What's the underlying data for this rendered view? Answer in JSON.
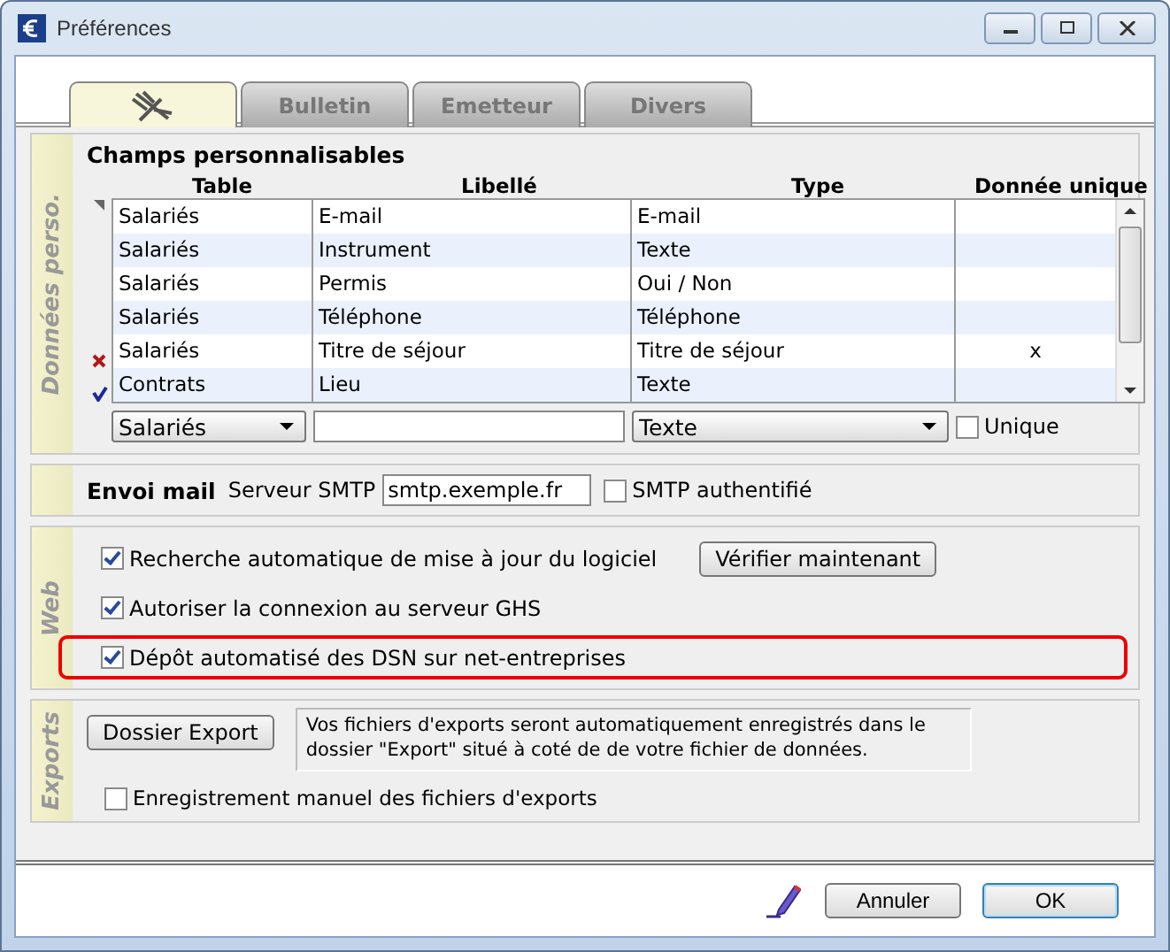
{
  "window": {
    "title": "Préférences"
  },
  "tabs": [
    {
      "kind": "icon",
      "selected": true
    },
    {
      "label": "Bulletin",
      "kind": "text",
      "selected": false
    },
    {
      "label": "Emetteur",
      "kind": "text",
      "selected": false
    },
    {
      "label": "Divers",
      "kind": "text",
      "selected": false
    }
  ],
  "custom_fields": {
    "side_label": "Données perso.",
    "title": "Champs personnalisables",
    "columns": [
      "Table",
      "Libellé",
      "Type",
      "Donnée unique"
    ],
    "rows": [
      {
        "kind": "current",
        "table": "Salariés",
        "label": "E-mail",
        "type": "E-mail"
      },
      {
        "kind": "plain",
        "table": "Salariés",
        "label": "Instrument",
        "type": "Texte"
      },
      {
        "kind": "plain",
        "table": "Salariés",
        "label": "Permis",
        "type": "Oui / Non"
      },
      {
        "kind": "plain",
        "table": "Salariés",
        "label": "Téléphone",
        "type": "Téléphone"
      },
      {
        "kind": "deleted",
        "table": "Salariés",
        "label": "Titre de séjour",
        "type": "Titre de séjour",
        "unique": "x"
      },
      {
        "kind": "validated",
        "table": "Contrats",
        "label": "Lieu",
        "type": "Texte"
      }
    ],
    "new_row": {
      "table": "Salariés",
      "type": "Texte",
      "unique": {
        "label": "Unique",
        "checked": false
      }
    }
  },
  "mail": {
    "title": "Envoi mail",
    "server_label": "Serveur SMTP",
    "server": "smtp.exemple.fr",
    "auth": {
      "label": "SMTP authentifié",
      "checked": false
    }
  },
  "web": {
    "side_label": "Web",
    "options": [
      {
        "label": "Recherche automatique de mise à jour du logiciel",
        "checked": true,
        "highlighted": false,
        "button": "Vérifier maintenant"
      },
      {
        "label": "Autoriser la connexion au serveur GHS",
        "checked": true,
        "highlighted": false
      },
      {
        "label": "Dépôt automatisé des DSN sur net-entreprises",
        "checked": true,
        "highlighted": true
      }
    ]
  },
  "exports": {
    "side_label": "Exports",
    "button": "Dossier Export",
    "note": "Vos fichiers d'exports seront automatiquement enregistrés dans le dossier \"Export\" situé à coté de de votre fichier de données.",
    "manual": {
      "label": "Enregistrement manuel des fichiers d'exports",
      "checked": false
    }
  },
  "buttons": [
    {
      "label": "Annuler",
      "default": false
    },
    {
      "label": "OK",
      "default": true
    }
  ]
}
